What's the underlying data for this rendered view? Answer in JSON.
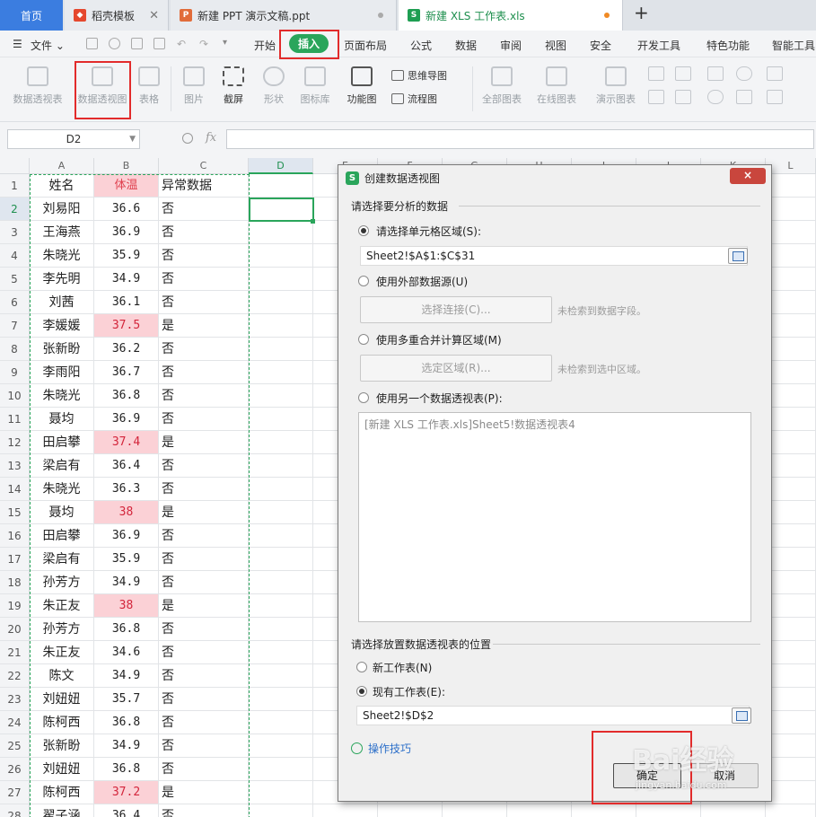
{
  "tabs": [
    {
      "label": "首页",
      "icon": "home-tab-icon"
    },
    {
      "label": "稻壳模板",
      "icon": "docer-icon",
      "icon_color": "#e5482e"
    },
    {
      "label": "新建 PPT 演示文稿.ppt",
      "icon": "ppt-icon",
      "icon_color": "#e16c3a"
    },
    {
      "label": "新建 XLS 工作表.xls",
      "icon": "xls-icon",
      "icon_color": "#1e9e52",
      "active": true
    }
  ],
  "menu": {
    "file": "文件",
    "items": [
      "开始",
      "插入",
      "页面布局",
      "公式",
      "数据",
      "审阅",
      "视图",
      "安全",
      "开发工具",
      "特色功能",
      "智能工具"
    ],
    "active": "插入"
  },
  "ribbon": {
    "pivot_table": "数据透视表",
    "pivot_chart": "数据透视图",
    "table": "表格",
    "picture": "图片",
    "screenshot": "截屏",
    "shape": "形状",
    "icon_lib": "图标库",
    "function_chart": "功能图",
    "mindmap": "思维导图",
    "flowchart": "流程图",
    "all_charts": "全部图表",
    "online_charts": "在线图表",
    "demo_charts": "演示图表"
  },
  "formula_bar": {
    "name_box": "D2",
    "fx": "fx",
    "value": ""
  },
  "sheet": {
    "columns": [
      "A",
      "B",
      "C",
      "D",
      "E",
      "F",
      "G",
      "H",
      "I",
      "J",
      "K",
      "L"
    ],
    "header": [
      "姓名",
      "体温",
      "异常数据"
    ],
    "rows": [
      {
        "n": "2",
        "name": "刘易阳",
        "temp": "36.6",
        "flag": "否"
      },
      {
        "n": "3",
        "name": "王海燕",
        "temp": "36.9",
        "flag": "否"
      },
      {
        "n": "4",
        "name": "朱晓光",
        "temp": "35.9",
        "flag": "否"
      },
      {
        "n": "5",
        "name": "李先明",
        "temp": "34.9",
        "flag": "否"
      },
      {
        "n": "6",
        "name": "刘茜",
        "temp": "36.1",
        "flag": "否"
      },
      {
        "n": "7",
        "name": "李媛媛",
        "temp": "37.5",
        "flag": "是"
      },
      {
        "n": "8",
        "name": "张新盼",
        "temp": "36.2",
        "flag": "否"
      },
      {
        "n": "9",
        "name": "李雨阳",
        "temp": "36.7",
        "flag": "否"
      },
      {
        "n": "10",
        "name": "朱晓光",
        "temp": "36.8",
        "flag": "否"
      },
      {
        "n": "11",
        "name": "聂均",
        "temp": "36.9",
        "flag": "否"
      },
      {
        "n": "12",
        "name": "田启攀",
        "temp": "37.4",
        "flag": "是"
      },
      {
        "n": "13",
        "name": "梁启有",
        "temp": "36.4",
        "flag": "否"
      },
      {
        "n": "14",
        "name": "朱晓光",
        "temp": "36.3",
        "flag": "否"
      },
      {
        "n": "15",
        "name": "聂均",
        "temp": "38",
        "flag": "是"
      },
      {
        "n": "16",
        "name": "田启攀",
        "temp": "36.9",
        "flag": "否"
      },
      {
        "n": "17",
        "name": "梁启有",
        "temp": "35.9",
        "flag": "否"
      },
      {
        "n": "18",
        "name": "孙芳方",
        "temp": "34.9",
        "flag": "否"
      },
      {
        "n": "19",
        "name": "朱正友",
        "temp": "38",
        "flag": "是"
      },
      {
        "n": "20",
        "name": "孙芳方",
        "temp": "36.8",
        "flag": "否"
      },
      {
        "n": "21",
        "name": "朱正友",
        "temp": "34.6",
        "flag": "否"
      },
      {
        "n": "22",
        "name": "陈文",
        "temp": "34.9",
        "flag": "否"
      },
      {
        "n": "23",
        "name": "刘妞妞",
        "temp": "35.7",
        "flag": "否"
      },
      {
        "n": "24",
        "name": "陈柯西",
        "temp": "36.8",
        "flag": "否"
      },
      {
        "n": "25",
        "name": "张新盼",
        "temp": "34.9",
        "flag": "否"
      },
      {
        "n": "26",
        "name": "刘妞妞",
        "temp": "36.8",
        "flag": "否"
      },
      {
        "n": "27",
        "name": "陈柯西",
        "temp": "37.2",
        "flag": "是"
      },
      {
        "n": "28",
        "name": "翟子涵",
        "temp": "36.4",
        "flag": "否"
      }
    ]
  },
  "dialog": {
    "title": "创建数据透视图",
    "close": "×",
    "section_source": "请选择要分析的数据",
    "opt_range": "请选择单元格区域(S):",
    "range_value": "Sheet2!$A$1:$C$31",
    "opt_external": "使用外部数据源(U)",
    "btn_connect": "选择连接(C)...",
    "hint_connect": "未检索到数据字段。",
    "opt_consolidate": "使用多重合并计算区域(M)",
    "btn_select_range": "选定区域(R)...",
    "hint_range": "未检索到选中区域。",
    "opt_other_pivot": "使用另一个数据透视表(P):",
    "other_pivot_item": "[新建 XLS 工作表.xls]Sheet5!数据透视表4",
    "section_dest": "请选择放置数据透视表的位置",
    "opt_new_sheet": "新工作表(N)",
    "opt_existing_sheet": "现有工作表(E):",
    "dest_value": "Sheet2!$D$2",
    "tips": "操作技巧",
    "ok": "确定",
    "cancel": "取消"
  },
  "watermark": {
    "brand": "Bai经验",
    "url": "jingyan.baidu.com"
  }
}
